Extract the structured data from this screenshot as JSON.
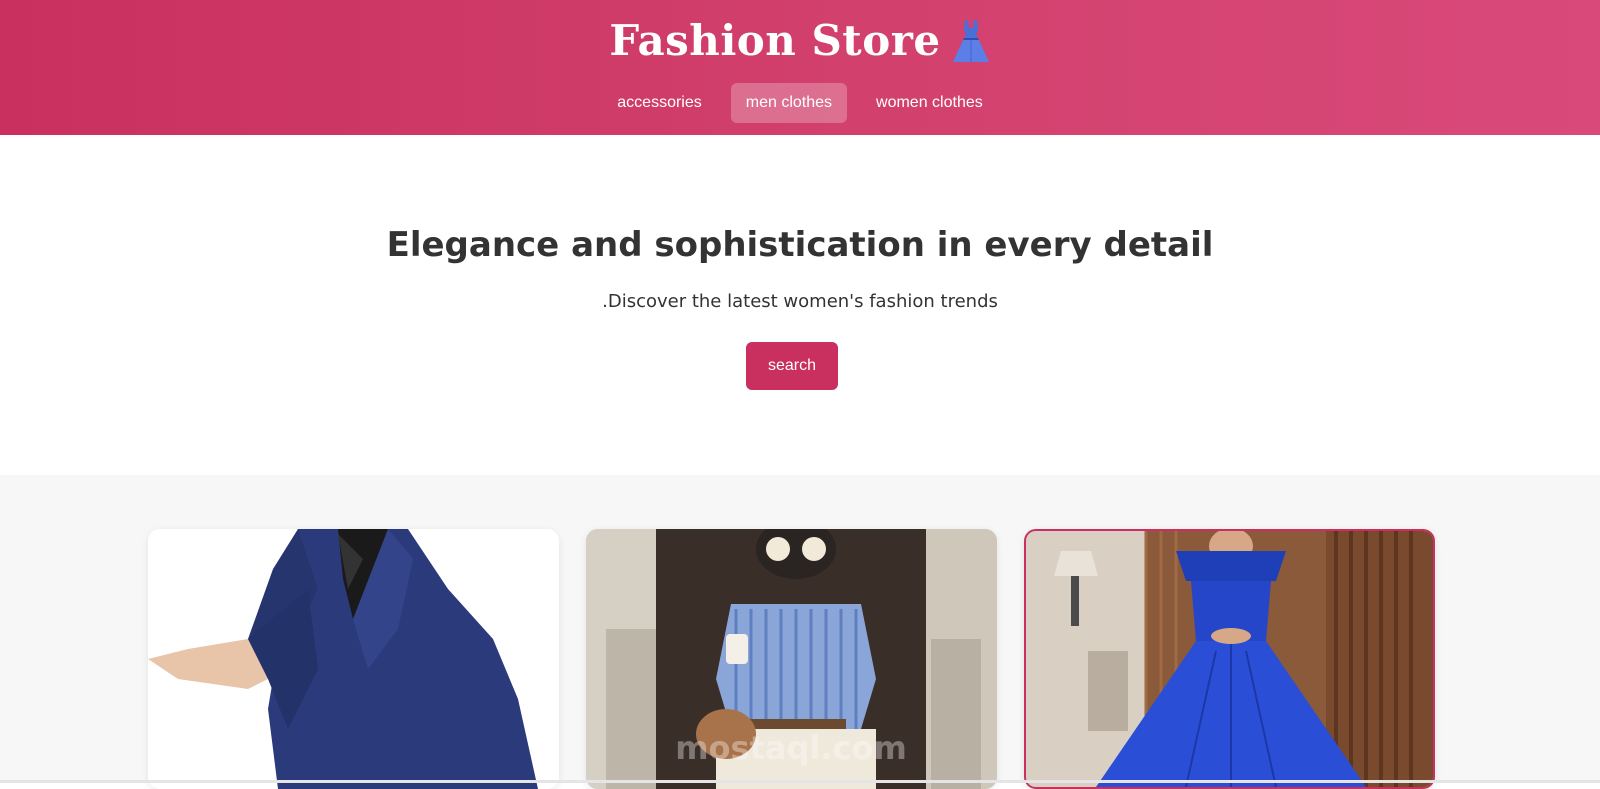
{
  "header": {
    "title": "Fashion Store",
    "logo_icon": "dress-icon",
    "nav": [
      {
        "label": "accessories",
        "active": false
      },
      {
        "label": "men clothes",
        "active": true
      },
      {
        "label": "women clothes",
        "active": false
      }
    ]
  },
  "hero": {
    "title": "Elegance and sophistication in every detail",
    "subtitle": ".Discover the latest women's fashion trends",
    "button_label": "search"
  },
  "products": [
    {
      "image": "navy-blazer-photo"
    },
    {
      "image": "striped-shirt-photo",
      "watermark": "mostaql.com"
    },
    {
      "image": "blue-gown-photo"
    }
  ],
  "colors": {
    "brand": "#c93060",
    "text": "#333333",
    "section_bg": "#f7f7f7"
  }
}
